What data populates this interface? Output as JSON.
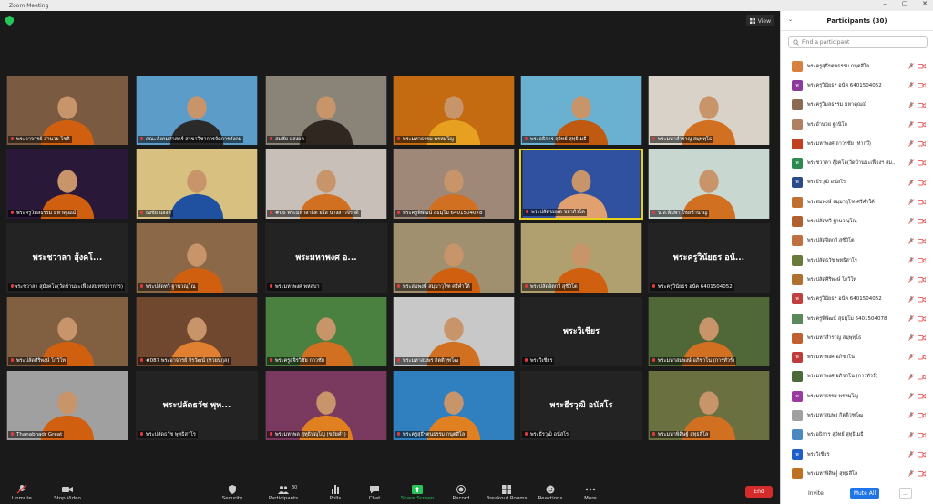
{
  "window": {
    "title": "Zoom Meeting",
    "minimize": "–",
    "maximize": "▢",
    "close": "✕"
  },
  "view_label": "View",
  "tiles": [
    {
      "name": "พระอาจารย์ อำนวย โชติ",
      "bg": "#7a5a40",
      "fg": "#d06010",
      "photo": true
    },
    {
      "name": "คณะสังคมศาสตร์ สาขาวิชาการจัดการสังคม",
      "bg": "#5c9cc8",
      "fg": "#2a2a2a",
      "photo": true
    },
    {
      "name": "สมชัย แสงผล",
      "bg": "#8a8378",
      "fg": "#302820",
      "photo": true
    },
    {
      "name": "พระมหาธรรม พรหมฺโญ",
      "bg": "#c46a10",
      "fg": "#e8a020",
      "photo": true
    },
    {
      "name": "พระอธิการ สุวิทย์ สุทฺธิเมธี",
      "bg": "#6ab0d0",
      "fg": "#c05a10",
      "photo": true
    },
    {
      "name": "พระมหาสำราญ สมฺพุทฺโธ",
      "bg": "#d8d2c8",
      "fg": "#d07020",
      "photo": true
    },
    {
      "name": "พระครูวิมลธรรม มหาคุณณ์",
      "bg": "#2a1838",
      "fg": "#d06010",
      "photo": true
    },
    {
      "name": "ธงชัย แสงสิ",
      "bg": "#d8c080",
      "fg": "#2050a0",
      "photo": true
    },
    {
      "name": "#06 พระมหาสาธิต ยโส นางสาวจีรวดี",
      "bg": "#c8c0b8",
      "fg": "#d07020",
      "photo": true
    },
    {
      "name": "พระครูพิพัฒน์ สุธมฺโม 6401504078",
      "bg": "#a08878",
      "fg": "#d07020",
      "photo": true
    },
    {
      "name": "พระปลัดชยพล ชยาภิรโต",
      "bg": "#3050a0",
      "fg": "#e0a070",
      "photo": true,
      "active": true
    },
    {
      "name": "น.ส.พิมพา ไชยชำนาญ",
      "bg": "#c8d8d0",
      "fg": "#d07020",
      "photo": true
    },
    {
      "name": "พระชวาลา สุมังคโล(วัดบ้านมะเฟืองสมุทรปราการ)",
      "big": "พระชวาลา สุ้งคโ..."
    },
    {
      "name": "พระปลัดทวี ฐานวณฺโณ",
      "bg": "#8a6848",
      "fg": "#d06010",
      "photo": true
    },
    {
      "name": "พระมหาพงศ พหลบา",
      "big": "พระมหาพงศ อ..."
    },
    {
      "name": "พระสมพงษ์ สมฺมาวุโฑ ศรีคำใต้",
      "bg": "#a09070",
      "fg": "#d06010",
      "photo": true
    },
    {
      "name": "พระปลัดจิตกวี สุชีวิโต",
      "bg": "#b0a070",
      "fg": "#d06010",
      "photo": true
    },
    {
      "name": "พระครูวินัยธร อนัค 6401504052",
      "big": "พระครูวินัยธร อนั..."
    },
    {
      "name": "พระปลัดศิริพงษ์ โกวิโท",
      "bg": "#806040",
      "fg": "#d06010",
      "photo": true
    },
    {
      "name": "#087 พระอาจารย์ จิรวัฒน์ (ทวยนกุล)",
      "bg": "#704830",
      "fg": "#e08030",
      "photo": true
    },
    {
      "name": "พระครูสุจิรวิชัย กาวชัย",
      "bg": "#4a8040",
      "fg": "#d07020",
      "photo": true
    },
    {
      "name": "พระมหาสมพร กิตติวุฑโฒ",
      "bg": "#c8c8c8",
      "fg": "#d07020",
      "photo": true
    },
    {
      "name": "พระวิเชียร",
      "big": "พระวิเชียร"
    },
    {
      "name": "พระมหาสมพงษ์ อภิชาโน (การทัวร์)",
      "bg": "#506838",
      "fg": "#d07020",
      "photo": true
    },
    {
      "name": "Thanabhadr Great",
      "bg": "#a0a0a0",
      "fg": "#d06010",
      "photo": true
    },
    {
      "name": "พระปลัดธวัช พุทธิสาโร",
      "big": "พระปลัดธวัช พุท..."
    },
    {
      "name": "พระมหาพล สุทฺธิปญฺโญ (ขยัยคำ)",
      "bg": "#7a3a60",
      "fg": "#e08020",
      "photo": true
    },
    {
      "name": "พระครูสุธีรตนธรรม กนฺตสีโล",
      "bg": "#3080c0",
      "fg": "#e08020",
      "photo": true
    },
    {
      "name": "พระธีรวุฒิ อนัสโร",
      "big": "พระธีรวุฒิ อนัสโร"
    },
    {
      "name": "พระมหาพิสิษฐ์ สุทฺธสีโล",
      "bg": "#6a7040",
      "fg": "#d07020",
      "photo": true
    }
  ],
  "toolbar": {
    "unmute": "Unmute",
    "stop_video": "Stop Video",
    "security": "Security",
    "participants": "Participants",
    "participants_count": "30",
    "polls": "Polls",
    "chat": "Chat",
    "share_screen": "Share Screen",
    "record": "Record",
    "breakout": "Breakout Rooms",
    "reactions": "Reactions",
    "more": "More",
    "end": "End"
  },
  "panel": {
    "title": "Participants (30)",
    "search_placeholder": "Find a participant",
    "invite": "Invite",
    "mute_all": "Mute All",
    "more": "..."
  },
  "participants": [
    {
      "name": "พระครูสุธีรตนธรรม กนฺตสีโล",
      "av": "#d88040"
    },
    {
      "name": "พระครูวินัยธร อนัค 6401504052",
      "av": "#8a3a9a",
      "initial": "พ"
    },
    {
      "name": "พระครูวิมลธรรม มหาคุณณ์",
      "av": "#8a6a50"
    },
    {
      "name": "พระอำนวย ฐานิโก",
      "av": "#b08060"
    },
    {
      "name": "พระมหาพงศ ถาวรชัย (ท่ากว๊)",
      "av": "#c04020"
    },
    {
      "name": "พระชวาลา สุ้งคโล(วัดบ้านมะเฟืองฯ สม..",
      "av": "#2a8a50",
      "initial": "พ"
    },
    {
      "name": "พระธีรวุฒิ อนัสโร",
      "av": "#2a4a8a",
      "initial": "พ"
    },
    {
      "name": "พระสมพงษ์ สมฺมาวุโฑ ศรีคำใต้",
      "av": "#c07030"
    },
    {
      "name": "พระปลัดทวี ฐานวณฺโณ",
      "av": "#b06030"
    },
    {
      "name": "พระปลัดจิตกวี สุชีวิโต",
      "av": "#c07040"
    },
    {
      "name": "พระปลัดธวัช พุทธิสาโร",
      "av": "#6a7a3a"
    },
    {
      "name": "พระปลัดศิริพงษ์ โกวิโท",
      "av": "#b07030"
    },
    {
      "name": "พระครูวินัยธร อนัค 6401504052",
      "av": "#c04040",
      "initial": "พ"
    },
    {
      "name": "พระครูพิพัฒน์ สุธมฺโม 6401504078",
      "av": "#5a8a5a"
    },
    {
      "name": "พระมหาสำราญ สมฺพุทฺโธ",
      "av": "#c06030"
    },
    {
      "name": "พระมหาพงศ อภิชาโน",
      "av": "#c03a3a",
      "initial": "พ"
    },
    {
      "name": "พระมหาพงศ อภิชาโน (การทัวร์)",
      "av": "#4a6a3a"
    },
    {
      "name": "พระมหาธรรม พรหมฺโญ",
      "av": "#9a3aa0",
      "initial": "พ"
    },
    {
      "name": "พระมหาสมพร กิตติวุฑโฒ",
      "av": "#a0a0a0"
    },
    {
      "name": "พระอธิการ สุวิทย์ สุทฺธิเมธี",
      "av": "#4a8ac0"
    },
    {
      "name": "พระวิเชียร",
      "av": "#1f5ec8",
      "initial": "พ"
    },
    {
      "name": "พระมหาพิสิษฐ์ สุทฺธสีโล",
      "av": "#c07020"
    }
  ]
}
